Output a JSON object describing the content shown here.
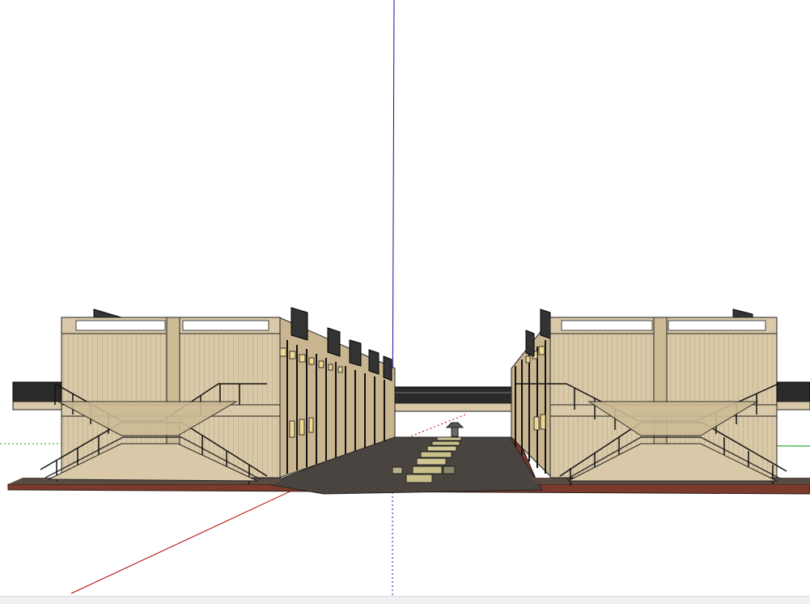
{
  "app": {
    "view": "3d-model-viewport"
  },
  "colors": {
    "background": "#ffffff",
    "axis_red": "#b40000",
    "axis_green": "#00a000",
    "axis_blue": "#1010a0",
    "wall": "#d9c9a8",
    "wall_shade": "#c9b690",
    "ground": "#4a4440",
    "plinth": "#7a3a2c",
    "bridge": "#2a2a2a",
    "window": "#f0d890",
    "railing": "#1a1a1a"
  },
  "icons": {
    "axis_origin": "axis-origin-icon"
  }
}
